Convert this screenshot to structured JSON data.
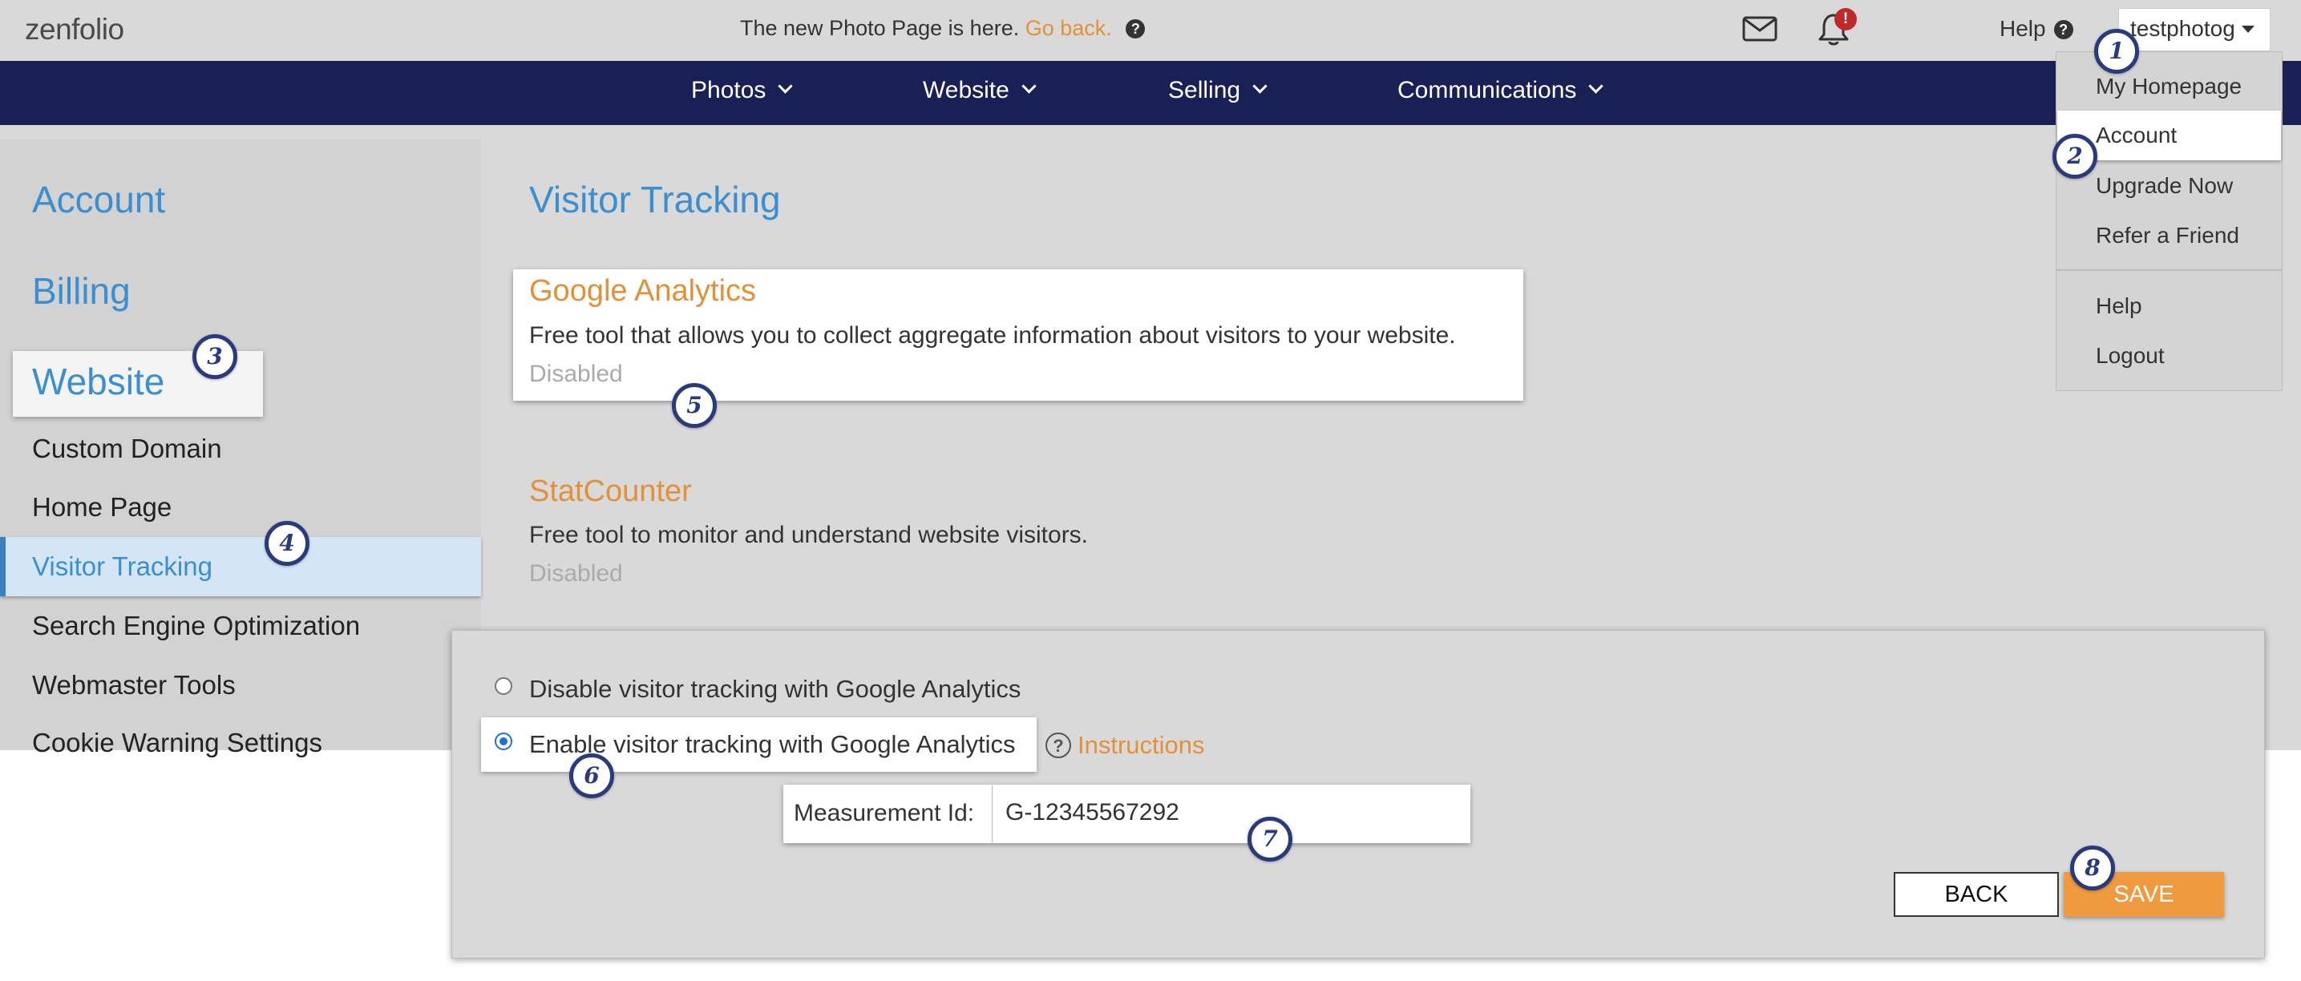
{
  "topbar": {
    "logo": "zenfolio",
    "announcement": "The new Photo Page is here.",
    "go_back": "Go back.",
    "notification_count": "!",
    "help_label": "Help",
    "username": "testphotog"
  },
  "nav": {
    "items": [
      {
        "label": "Photos"
      },
      {
        "label": "Website"
      },
      {
        "label": "Selling"
      },
      {
        "label": "Communications"
      }
    ]
  },
  "user_menu": {
    "items": [
      {
        "label": "My Homepage"
      },
      {
        "label": "Account"
      },
      {
        "label": "Upgrade Now"
      },
      {
        "label": "Refer a Friend"
      },
      {
        "label": "Help"
      },
      {
        "label": "Logout"
      }
    ]
  },
  "sidebar": {
    "headings": [
      "Account",
      "Billing",
      "Website"
    ],
    "items": [
      {
        "label": "Custom Domain"
      },
      {
        "label": "Home Page"
      },
      {
        "label": "Visitor Tracking"
      },
      {
        "label": "Search Engine Optimization"
      },
      {
        "label": "Webmaster Tools"
      },
      {
        "label": "Cookie Warning Settings"
      }
    ]
  },
  "main": {
    "title": "Visitor Tracking",
    "services": [
      {
        "name": "Google Analytics",
        "description": "Free tool that allows you to collect aggregate information about visitors to your website.",
        "status": "Disabled"
      },
      {
        "name": "StatCounter",
        "description": "Free tool to monitor and understand website visitors.",
        "status": "Disabled"
      }
    ]
  },
  "panel": {
    "option_disable": "Disable visitor tracking with Google Analytics",
    "option_enable": "Enable visitor tracking with Google Analytics",
    "selected_option": "enable",
    "instructions": "Instructions",
    "measurement_label": "Measurement Id:",
    "measurement_value": "G-12345567292",
    "back_label": "BACK",
    "save_label": "SAVE"
  },
  "markers": [
    "1",
    "2",
    "3",
    "4",
    "5",
    "6",
    "7",
    "8"
  ],
  "colors": {
    "navbar": "#182055",
    "accent_blue": "#3b8fd1",
    "accent_orange": "#e0913a",
    "save_button": "#ef9a3f",
    "notification_badge": "#c0292b",
    "marker": "#2a3a7c"
  }
}
